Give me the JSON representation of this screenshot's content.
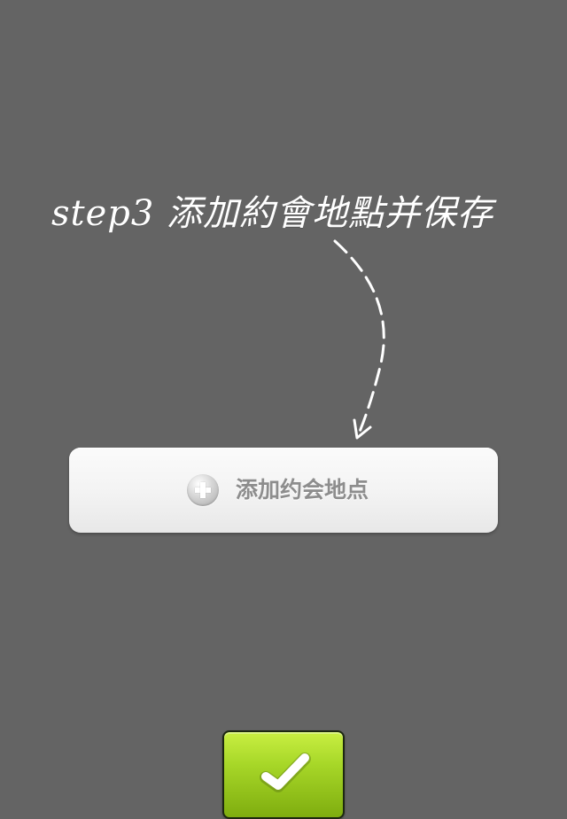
{
  "overlay": {
    "background_color": "#646464",
    "title": "step3 添加約會地點并保存"
  },
  "add_location_button": {
    "icon": "plus-circle-icon",
    "label": "添加约会地点"
  },
  "confirm_button": {
    "icon": "checkmark-icon",
    "color": "#91c11b"
  }
}
